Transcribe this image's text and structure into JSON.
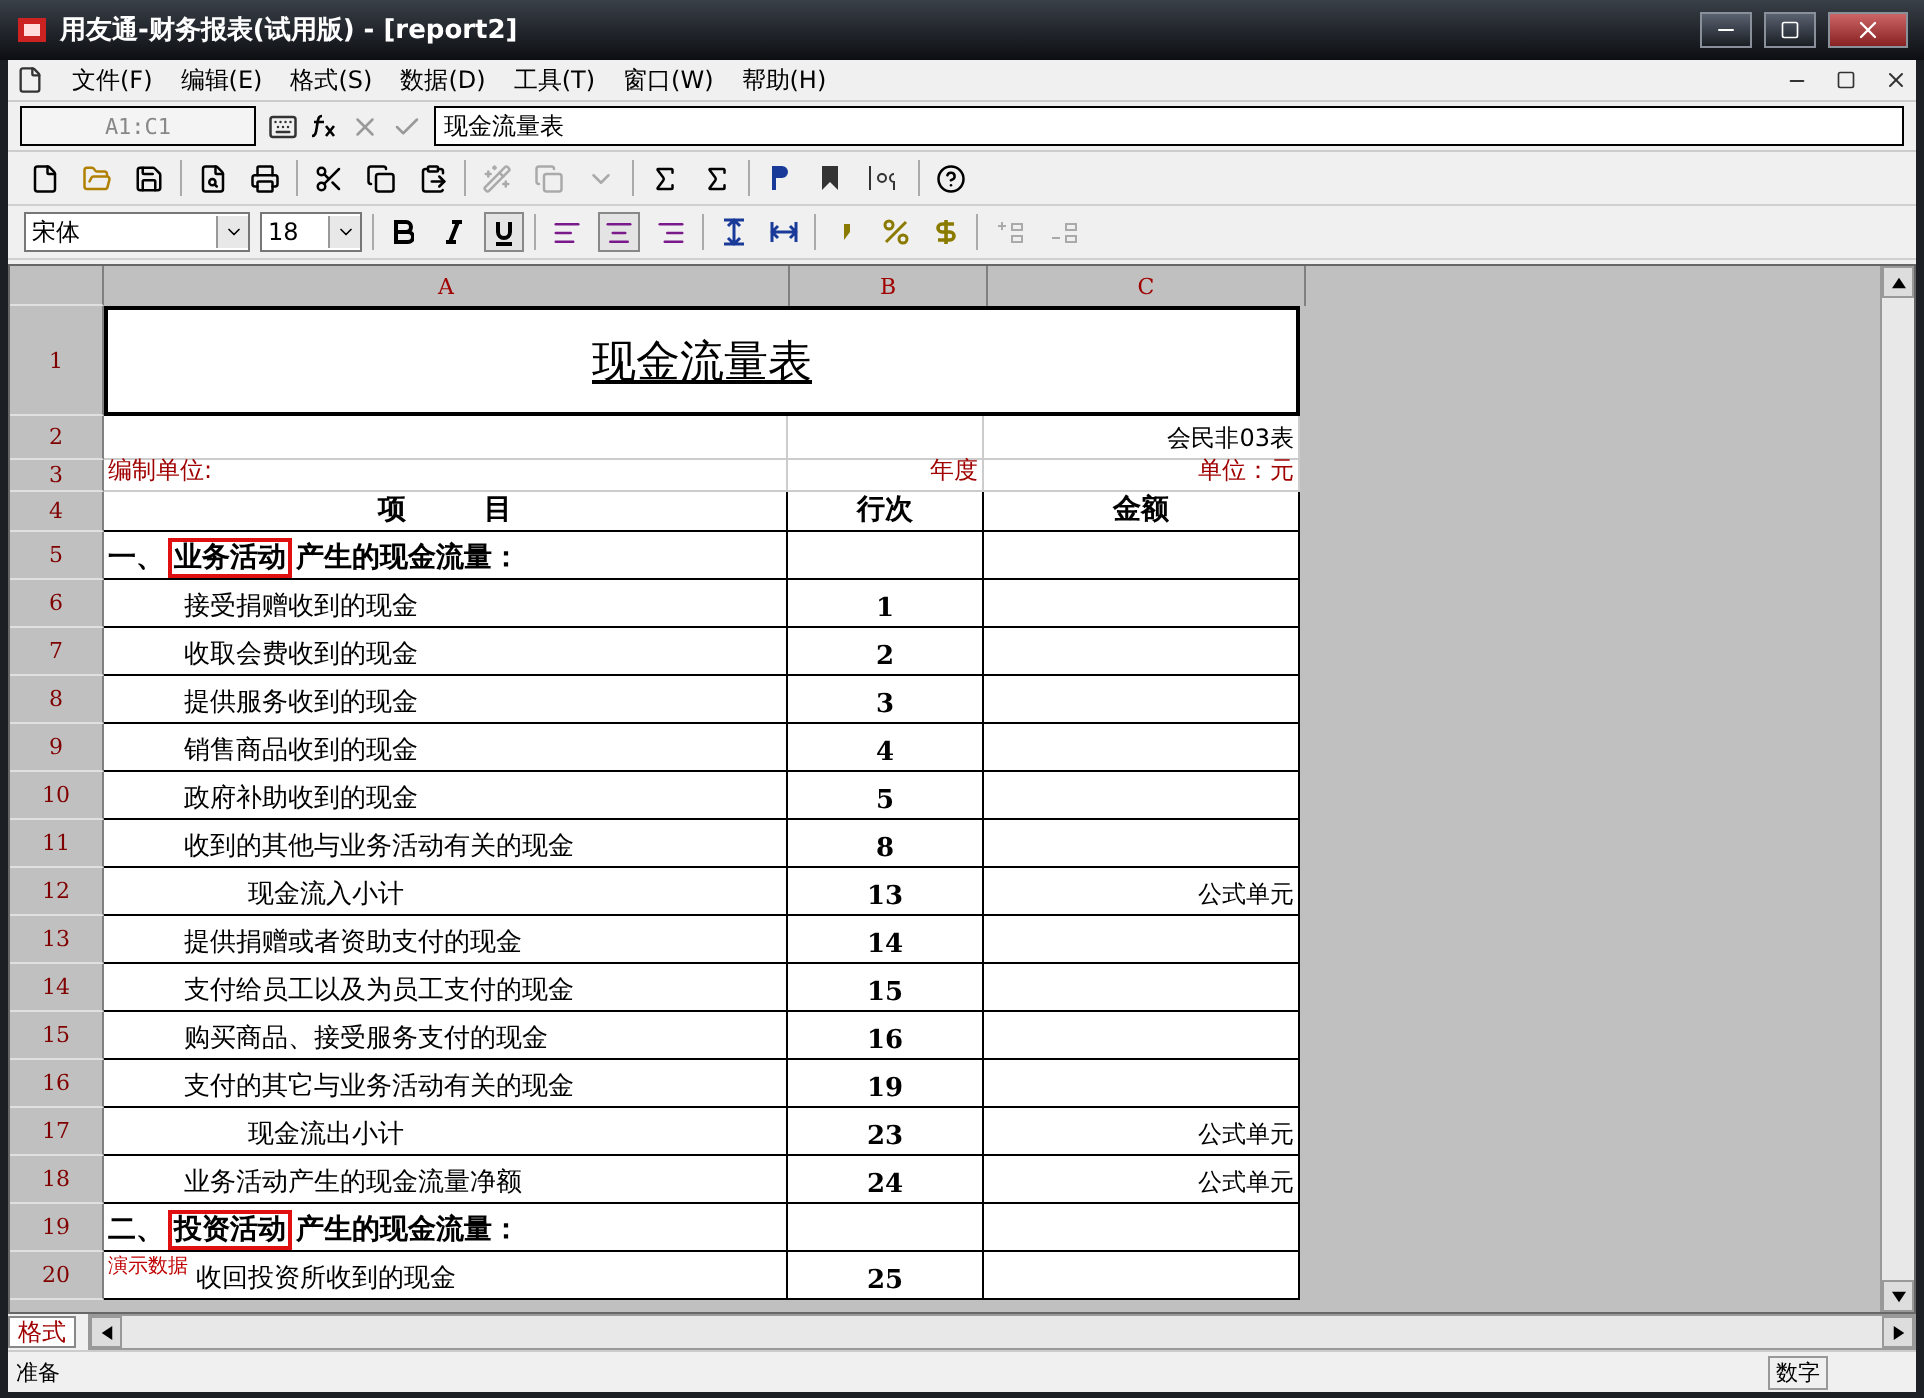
{
  "window": {
    "title": "用友通-财务报表(试用版) - [report2]"
  },
  "menu": [
    "文件(F)",
    "编辑(E)",
    "格式(S)",
    "数据(D)",
    "工具(T)",
    "窗口(W)",
    "帮助(H)"
  ],
  "formula_bar": {
    "cell_ref": "A1:C1",
    "value": "现金流量表"
  },
  "format_bar": {
    "font": "宋体",
    "size": "18",
    "bold": false,
    "italic": false,
    "underline": true,
    "align_left": false,
    "align_center": true,
    "align_right": false
  },
  "sheet": {
    "columns": [
      "A",
      "B",
      "C"
    ],
    "rows": [
      {
        "num": "1",
        "kind": "title",
        "a": "现金流量表"
      },
      {
        "num": "2",
        "kind": "note",
        "c": "会民非03表"
      },
      {
        "num": "3",
        "kind": "meta",
        "a": "编制单位:",
        "b": "年度",
        "c": "单位：元"
      },
      {
        "num": "4",
        "kind": "header",
        "a": "项        目",
        "b": "行次",
        "c": "金额"
      },
      {
        "num": "5",
        "kind": "section",
        "prefix": "一、",
        "highlighted": "业务活动",
        "suffix": "产生的现金流量："
      },
      {
        "num": "6",
        "kind": "item",
        "a": "接受捐赠收到的现金",
        "b": "1"
      },
      {
        "num": "7",
        "kind": "item",
        "a": "收取会费收到的现金",
        "b": "2"
      },
      {
        "num": "8",
        "kind": "item",
        "a": "提供服务收到的现金",
        "b": "3"
      },
      {
        "num": "9",
        "kind": "item",
        "a": "销售商品收到的现金",
        "b": "4"
      },
      {
        "num": "10",
        "kind": "item",
        "a": "政府补助收到的现金",
        "b": "5"
      },
      {
        "num": "11",
        "kind": "item",
        "a": "收到的其他与业务活动有关的现金",
        "b": "8"
      },
      {
        "num": "12",
        "kind": "subtotal",
        "a": "现金流入小计",
        "b": "13",
        "c": "公式单元"
      },
      {
        "num": "13",
        "kind": "item",
        "a": "提供捐赠或者资助支付的现金",
        "b": "14"
      },
      {
        "num": "14",
        "kind": "item",
        "a": "支付给员工以及为员工支付的现金",
        "b": "15"
      },
      {
        "num": "15",
        "kind": "item",
        "a": "购买商品、接受服务支付的现金",
        "b": "16"
      },
      {
        "num": "16",
        "kind": "item",
        "a": "支付的其它与业务活动有关的现金",
        "b": "19"
      },
      {
        "num": "17",
        "kind": "subtotal",
        "a": "现金流出小计",
        "b": "23",
        "c": "公式单元"
      },
      {
        "num": "18",
        "kind": "item",
        "a": "业务活动产生的现金流量净额",
        "b": "24",
        "c": "公式单元"
      },
      {
        "num": "19",
        "kind": "section",
        "prefix": "二、",
        "highlighted": "投资活动",
        "suffix": "产生的现金流量："
      },
      {
        "num": "20",
        "kind": "item",
        "a": "收回投资所收到的现金",
        "b": "25",
        "stamp": "演示数据"
      }
    ]
  },
  "sheet_tab": "格式",
  "status_bar": {
    "message": "准备",
    "mode": "数字"
  }
}
